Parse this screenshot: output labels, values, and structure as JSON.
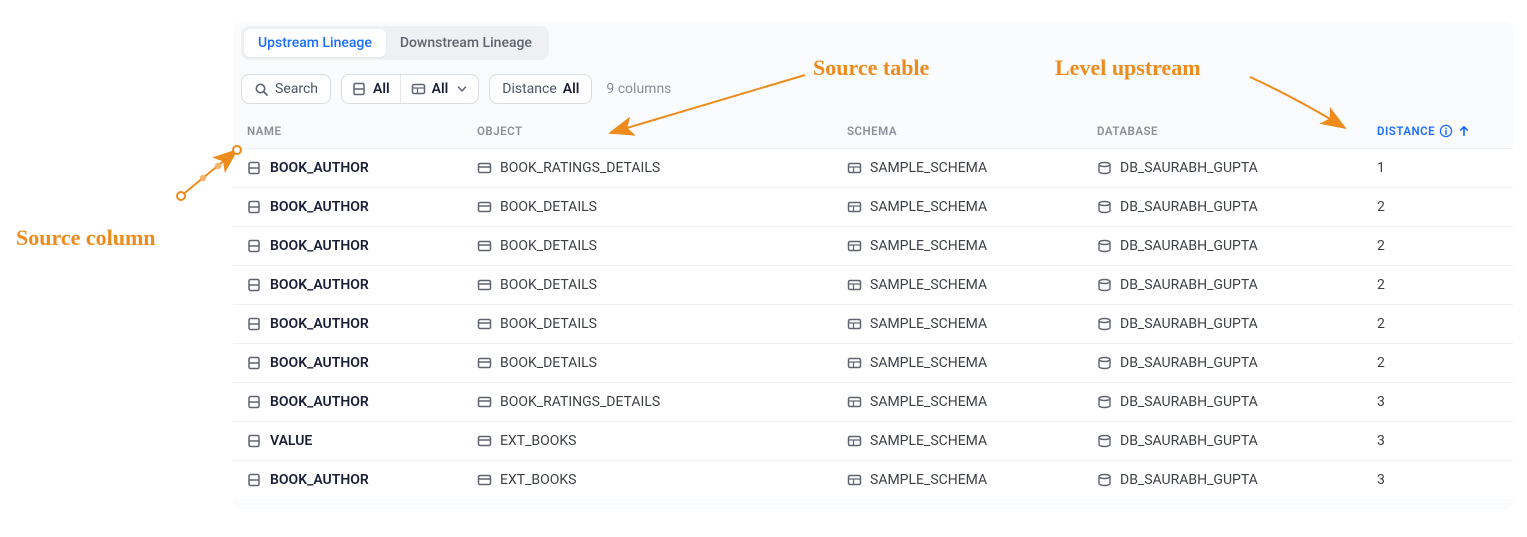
{
  "tabs": {
    "upstream": "Upstream Lineage",
    "downstream": "Downstream Lineage"
  },
  "toolbar": {
    "search": "Search",
    "filter1_label": "All",
    "filter2_label": "All",
    "distance_prefix": "Distance",
    "distance_value": "All",
    "column_count": "9 columns"
  },
  "columns": {
    "name": "NAME",
    "object": "OBJECT",
    "schema": "SCHEMA",
    "database": "DATABASE",
    "distance": "DISTANCE"
  },
  "rows": [
    {
      "name": "BOOK_AUTHOR",
      "object": "BOOK_RATINGS_DETAILS",
      "schema": "SAMPLE_SCHEMA",
      "database": "DB_SAURABH_GUPTA",
      "distance": "1"
    },
    {
      "name": "BOOK_AUTHOR",
      "object": "BOOK_DETAILS",
      "schema": "SAMPLE_SCHEMA",
      "database": "DB_SAURABH_GUPTA",
      "distance": "2"
    },
    {
      "name": "BOOK_AUTHOR",
      "object": "BOOK_DETAILS",
      "schema": "SAMPLE_SCHEMA",
      "database": "DB_SAURABH_GUPTA",
      "distance": "2"
    },
    {
      "name": "BOOK_AUTHOR",
      "object": "BOOK_DETAILS",
      "schema": "SAMPLE_SCHEMA",
      "database": "DB_SAURABH_GUPTA",
      "distance": "2"
    },
    {
      "name": "BOOK_AUTHOR",
      "object": "BOOK_DETAILS",
      "schema": "SAMPLE_SCHEMA",
      "database": "DB_SAURABH_GUPTA",
      "distance": "2"
    },
    {
      "name": "BOOK_AUTHOR",
      "object": "BOOK_DETAILS",
      "schema": "SAMPLE_SCHEMA",
      "database": "DB_SAURABH_GUPTA",
      "distance": "2"
    },
    {
      "name": "BOOK_AUTHOR",
      "object": "BOOK_RATINGS_DETAILS",
      "schema": "SAMPLE_SCHEMA",
      "database": "DB_SAURABH_GUPTA",
      "distance": "3"
    },
    {
      "name": "VALUE",
      "object": "EXT_BOOKS",
      "schema": "SAMPLE_SCHEMA",
      "database": "DB_SAURABH_GUPTA",
      "distance": "3"
    },
    {
      "name": "BOOK_AUTHOR",
      "object": "EXT_BOOKS",
      "schema": "SAMPLE_SCHEMA",
      "database": "DB_SAURABH_GUPTA",
      "distance": "3"
    }
  ],
  "annotations": {
    "source_column": "Source column",
    "source_table": "Source table",
    "level_upstream": "Level upstream"
  }
}
